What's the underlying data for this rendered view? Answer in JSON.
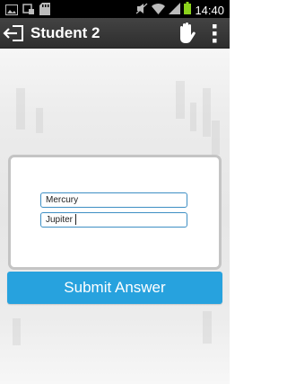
{
  "status_bar": {
    "time": "14:40",
    "icons": [
      "image-icon",
      "usb-icon",
      "sd-card-icon",
      "mute-icon",
      "wifi-icon",
      "signal-icon",
      "battery-icon"
    ]
  },
  "action_bar": {
    "title": "Student 2",
    "icons": [
      "back-icon",
      "raise-hand-icon",
      "overflow-menu-icon"
    ],
    "background": "#3a3a3a"
  },
  "answer_form": {
    "fields": [
      {
        "value": "Mercury"
      },
      {
        "value": "Jupiter"
      }
    ],
    "submit_label": "Submit Answer",
    "accent_color": "#27a2de"
  }
}
